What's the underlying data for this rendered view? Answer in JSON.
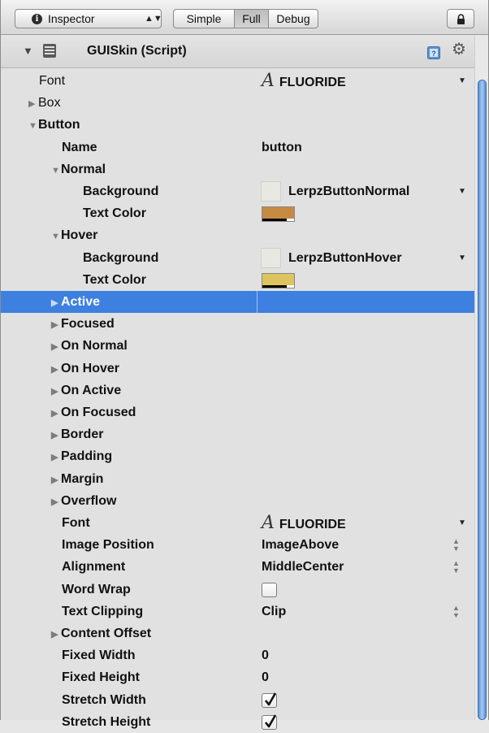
{
  "toolbar": {
    "panel_label": "Inspector",
    "modes": [
      "Simple",
      "Full",
      "Debug"
    ],
    "active_mode": "Full"
  },
  "component": {
    "title": "GUISkin (Script)"
  },
  "rows": [
    {
      "label": "Font",
      "value": "FLUORIDE",
      "kind": "font"
    },
    {
      "label": "Box",
      "kind": "foldout",
      "expanded": false
    },
    {
      "label": "Button",
      "kind": "foldout",
      "expanded": true
    },
    {
      "label": "Name",
      "value": "button",
      "kind": "text"
    },
    {
      "label": "Normal",
      "kind": "foldout",
      "expanded": true
    },
    {
      "label": "Background",
      "value": "LerpzButtonNormal",
      "kind": "texture"
    },
    {
      "label": "Text Color",
      "kind": "color",
      "color": "#c58a42"
    },
    {
      "label": "Hover",
      "kind": "foldout",
      "expanded": true
    },
    {
      "label": "Background",
      "value": "LerpzButtonHover",
      "kind": "texture"
    },
    {
      "label": "Text Color",
      "kind": "color",
      "color": "#dcc45e"
    },
    {
      "label": "Active",
      "kind": "foldout",
      "expanded": false,
      "selected": true
    },
    {
      "label": "Focused",
      "kind": "foldout",
      "expanded": false
    },
    {
      "label": "On Normal",
      "kind": "foldout",
      "expanded": false
    },
    {
      "label": "On Hover",
      "kind": "foldout",
      "expanded": false
    },
    {
      "label": "On Active",
      "kind": "foldout",
      "expanded": false
    },
    {
      "label": "On Focused",
      "kind": "foldout",
      "expanded": false
    },
    {
      "label": "Border",
      "kind": "foldout",
      "expanded": false
    },
    {
      "label": "Padding",
      "kind": "foldout",
      "expanded": false
    },
    {
      "label": "Margin",
      "kind": "foldout",
      "expanded": false
    },
    {
      "label": "Overflow",
      "kind": "foldout",
      "expanded": false
    },
    {
      "label": "Font",
      "value": "FLUORIDE",
      "kind": "font"
    },
    {
      "label": "Image Position",
      "value": "ImageAbove",
      "kind": "enum"
    },
    {
      "label": "Alignment",
      "value": "MiddleCenter",
      "kind": "enum"
    },
    {
      "label": "Word Wrap",
      "kind": "checkbox",
      "checked": false
    },
    {
      "label": "Text Clipping",
      "value": "Clip",
      "kind": "enum"
    },
    {
      "label": "Content Offset",
      "kind": "foldout",
      "expanded": false
    },
    {
      "label": "Fixed Width",
      "value": "0",
      "kind": "text"
    },
    {
      "label": "Fixed Height",
      "value": "0",
      "kind": "text"
    },
    {
      "label": "Stretch Width",
      "kind": "checkbox",
      "checked": true
    },
    {
      "label": "Stretch Height",
      "kind": "checkbox",
      "checked": true
    }
  ],
  "colors": {
    "selection": "#3d80df",
    "panel_bg": "#e1e1e1"
  }
}
